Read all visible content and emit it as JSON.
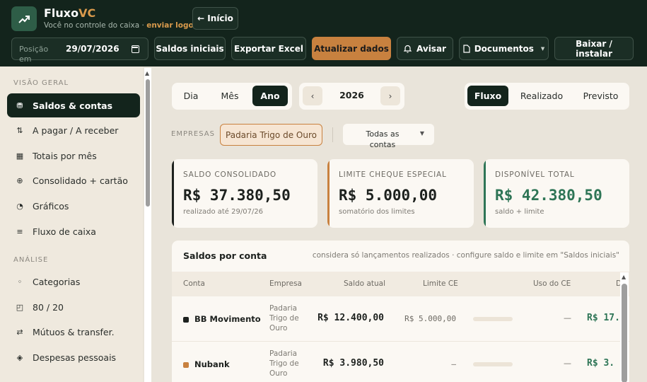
{
  "header": {
    "brand_main": "Fluxo",
    "brand_accent": "VC",
    "tagline": "Você no controle do caixa",
    "tagline_sep": " · ",
    "logo_link": "enviar logo",
    "home_button": "← Início",
    "position_label": "Posição em",
    "position_date": "29/07/2026",
    "buttons": {
      "saldos_iniciais": "Saldos iniciais",
      "exportar_excel": "Exportar Excel",
      "atualizar_dados": "Atualizar dados",
      "avisar": "Avisar",
      "documentos": "Documentos",
      "baixar_instalar": "Baixar / instalar"
    }
  },
  "sidebar": {
    "section_geral": "VISÃO GERAL",
    "section_analise": "ANÁLISE",
    "items": [
      {
        "label": "Saldos & contas",
        "icon": "coins-icon",
        "glyph": "⛃"
      },
      {
        "label": "A pagar / A receber",
        "icon": "swap-vertical-icon",
        "glyph": "⇅"
      },
      {
        "label": "Totais por mês",
        "icon": "grid-icon",
        "glyph": "▦"
      },
      {
        "label": "Consolidado + cartão",
        "icon": "globe-icon",
        "glyph": "⊕"
      },
      {
        "label": "Gráficos",
        "icon": "pie-chart-icon",
        "glyph": "◔"
      },
      {
        "label": "Fluxo de caixa",
        "icon": "list-icon",
        "glyph": "≡"
      },
      {
        "label": "Categorias",
        "icon": "tag-icon",
        "glyph": "◦"
      },
      {
        "label": "80 / 20",
        "icon": "chart-box-icon",
        "glyph": "◰"
      },
      {
        "label": "Mútuos & transfer.",
        "icon": "transfer-icon",
        "glyph": "⇄"
      },
      {
        "label": "Despesas pessoais",
        "icon": "diamond-icon",
        "glyph": "◈"
      }
    ]
  },
  "period_tabs": [
    "Dia",
    "Mês",
    "Ano"
  ],
  "active_period": "Ano",
  "year": "2026",
  "view_tabs": [
    "Fluxo",
    "Realizado",
    "Previsto"
  ],
  "active_view": "Fluxo",
  "filters": {
    "empresas_label": "EMPRESAS",
    "empresa_selected": "Padaria Trigo de Ouro",
    "contas_selected": "Todas as contas"
  },
  "cards": [
    {
      "title": "SALDO CONSOLIDADO",
      "value": "R$ 37.380,50",
      "sub": "realizado até 29/07/26",
      "accent": "#1d211e"
    },
    {
      "title": "LIMITE CHEQUE ESPECIAL",
      "value": "R$ 5.000,00",
      "sub": "somatório dos limites",
      "accent": "#c8813f"
    },
    {
      "title": "DISPONÍVEL TOTAL",
      "value": "R$ 42.380,50",
      "sub": "saldo + limite",
      "accent": "#2e7556"
    }
  ],
  "table": {
    "title": "Saldos por conta",
    "note": "considera só lançamentos realizados · configure saldo e limite em \"Saldos iniciais\"",
    "columns": [
      "Conta",
      "Empresa",
      "Saldo atual",
      "Limite CE",
      "Uso do CE",
      "D"
    ],
    "rows": [
      {
        "conta": "BB Movimento",
        "empresa": "Padaria Trigo de Ouro",
        "saldo": "R$ 12.400,00",
        "limite": "R$ 5.000,00",
        "uso": "—",
        "disp": "R$ 17.",
        "color": "#1d211e"
      },
      {
        "conta": "Nubank",
        "empresa": "Padaria Trigo de Ouro",
        "saldo": "R$ 3.980,50",
        "limite": "—",
        "uso": "—",
        "disp": "R$ 3.",
        "color": "#c8813f"
      }
    ]
  },
  "colors": {
    "dark": "#13241c",
    "accent": "#c8813f",
    "green": "#2e7556"
  }
}
